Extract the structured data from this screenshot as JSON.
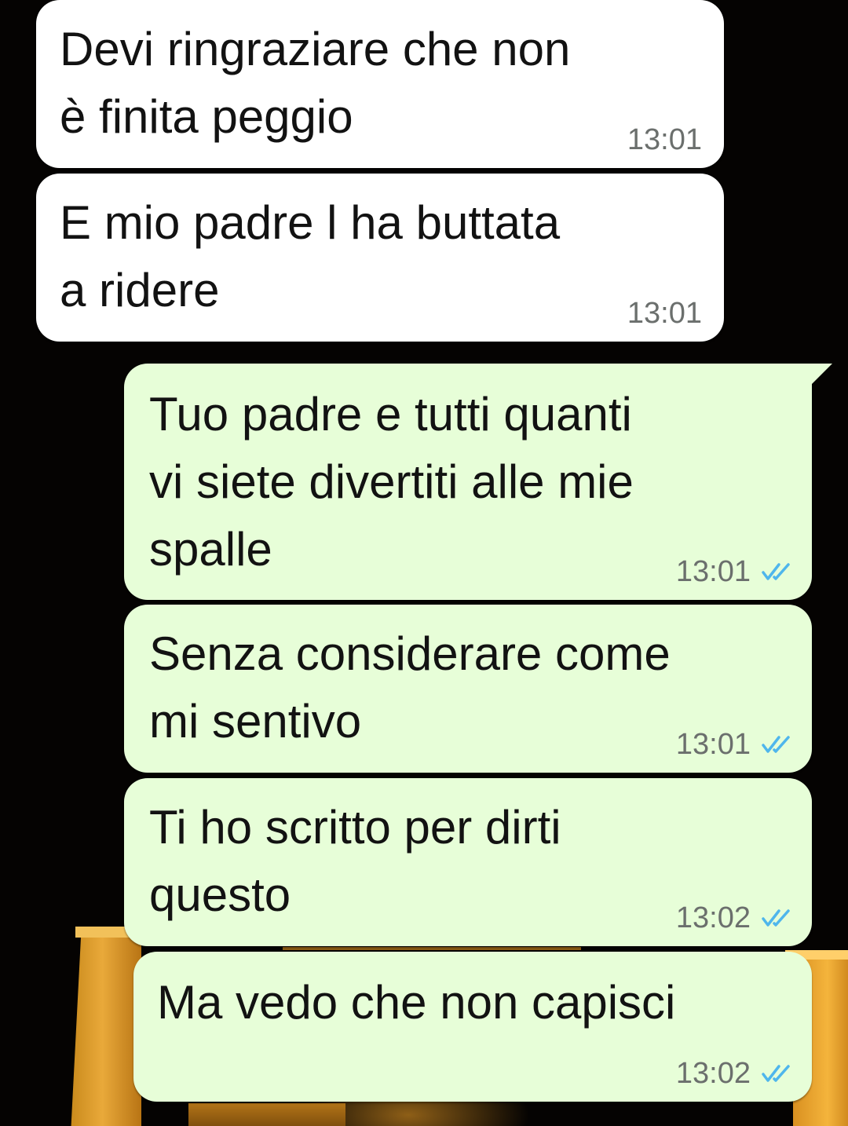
{
  "chat": {
    "messages": [
      {
        "direction": "incoming",
        "text": "Devi ringraziare che non\nè finita peggio",
        "time": "13:01"
      },
      {
        "direction": "incoming",
        "text": "E mio padre l ha buttata\na ridere",
        "time": "13:01"
      },
      {
        "direction": "outgoing",
        "text": "Tuo padre e tutti quanti\nvi siete divertiti alle mie\nspalle",
        "time": "13:01",
        "status": "read"
      },
      {
        "direction": "outgoing",
        "text": "Senza considerare come\nmi sentivo",
        "time": "13:01",
        "status": "read"
      },
      {
        "direction": "outgoing",
        "text": "Ti ho scritto per dirti\nquesto",
        "time": "13:02",
        "status": "read"
      },
      {
        "direction": "outgoing",
        "text": "Ma vedo che non capisci",
        "time": "13:02",
        "status": "read"
      }
    ]
  },
  "colors": {
    "incoming_bubble": "#ffffff",
    "outgoing_bubble": "#e7fed8",
    "read_ticks": "#4fb6ec",
    "timestamp": "#6b6f6d"
  },
  "icons": {
    "read_status": "double-check-icon"
  }
}
